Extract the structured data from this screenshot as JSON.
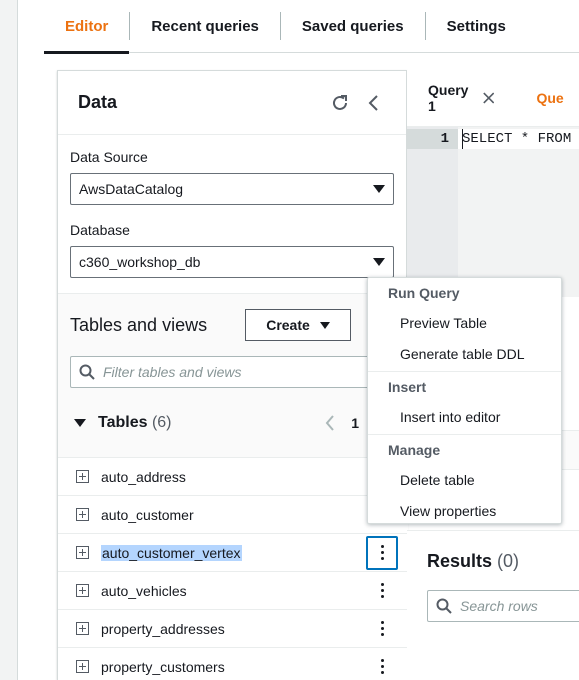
{
  "top_tabs": [
    "Editor",
    "Recent queries",
    "Saved queries",
    "Settings"
  ],
  "data_panel": {
    "title": "Data",
    "data_source_label": "Data Source",
    "data_source_value": "AwsDataCatalog",
    "database_label": "Database",
    "database_value": "c360_workshop_db",
    "tables_and_views_title": "Tables and views",
    "create_label": "Create",
    "filter_placeholder": "Filter tables and views",
    "tables_label": "Tables",
    "tables_count": "(6)",
    "page_number": "1",
    "tables": [
      {
        "name": "auto_address"
      },
      {
        "name": "auto_customer"
      },
      {
        "name": "auto_customer_vertex"
      },
      {
        "name": "auto_vehicles"
      },
      {
        "name": "property_addresses"
      },
      {
        "name": "property_customers"
      }
    ],
    "selected_table": "auto_customer_vertex"
  },
  "editor": {
    "tabs": [
      "Query 1",
      "Que"
    ],
    "line_number": "1",
    "code_line": "SELECT * FROM"
  },
  "results": {
    "title": "Results",
    "count": "(0)",
    "search_placeholder": "Search rows"
  },
  "context_menu": {
    "groups": [
      {
        "header": "Run Query",
        "items": [
          "Preview Table",
          "Generate table DDL"
        ]
      },
      {
        "header": "Insert",
        "items": [
          "Insert into editor"
        ]
      },
      {
        "header": "Manage",
        "items": [
          "Delete table",
          "View properties"
        ]
      }
    ]
  },
  "colors": {
    "accent": "#ec7211",
    "focus": "#0073bb",
    "selection": "#b4d5fe"
  }
}
